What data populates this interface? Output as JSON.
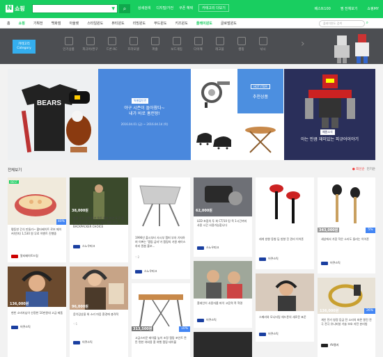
{
  "header": {
    "logo_letter": "N",
    "logo_text": "쇼핑",
    "search_dropdown": "▼",
    "search_button": "⌕",
    "links": [
      "상세검색",
      "디지털/가전",
      "쿠폰 혜택",
      "카테고리 더보기"
    ],
    "right": [
      "베스트100",
      "찜 전체보기",
      "쇼핑MY"
    ]
  },
  "categories": {
    "items": [
      "홈",
      "쇼핑",
      "기획전",
      "백화점",
      "아울렛",
      "스타일윈도",
      "뷰티윈도",
      "리빙윈도",
      "푸드윈도",
      "키즈윈도",
      "플레이윈도",
      "글로벌윈도"
    ],
    "active_index": 1,
    "highlight_index": 10,
    "search_placeholder": "플레이윈도 검색"
  },
  "darkbar": {
    "category_label": "카테고리",
    "category_sub": "Category",
    "subcats": [
      "인기상품",
      "피규어/완구",
      "드론·RC",
      "프라모델",
      "퍼즐",
      "보드게임",
      "다이캐",
      "레고블",
      "캠핑",
      "낚시"
    ]
  },
  "banner": {
    "b2_tag": "특별할인전",
    "b2_title_1": "야구 시즌이 돌아왔다~",
    "b2_title_2": "내가 바로 홈런왕!",
    "b2_date": "2016.04.01 (금) ~ 2016.04.14 (목)",
    "b3_hot": "HOT ITEM",
    "b3_title": "추천상품",
    "b4_tag": "예원소식",
    "b4_title": "아는 만큼 재미있는 피규어이야기"
  },
  "section": {
    "title": "전체보기",
    "sort_active": "● 최신순",
    "sort_other": "인기순"
  },
  "cards": [
    {
      "badge": "BEST",
      "pct": "40%",
      "desc": "평등한 간식 만들기~ 왈타베이트 로보 메이커(반지) 1,530 원 무료 이벤트 진행중",
      "seller": "알티메이트드림"
    },
    {
      "price": "38,000원",
      "desc": "친환 친환 친환 화선 목트 콜라 자연 도구 캠핑 노면 공용 보트 도우 자리 캠핑 친환 BACKPACKER CHOICE",
      "seller": "스노우피크"
    },
    {
      "desc": "1996년 출시부터 사시부 캠퍼 부자 기지하여 이쁘는 '캠핑 굽자'가 캠핑의 기원 캐이스 하리 뭔봅 풀보...",
      "seller": "스노우피크",
      "meta": "♡2"
    },
    {
      "price": "62,000원",
      "desc": "LED 초점의 투 회 CT/10 킹 목 1시간까지 사용 시간 사용가능합니다",
      "seller": "스노우피크"
    },
    {
      "price": "",
      "desc": "레게 방향 동형 딥 방향 진 관리 이어폰",
      "seller": "어쿠스틱",
      "meta": "♡2"
    },
    {
      "price": "343,000원",
      "pct": "5%",
      "desc": "세상에서 가장 작은 소리도 들리는 이어폰",
      "seller": "어쿠스틱"
    },
    {
      "price": "136,000원",
      "desc": "현빈 소비자님이 선정한 10만원대 고급 제품",
      "seller": "어쿠스틱"
    },
    {
      "price": "96,000원",
      "desc": "음악감상을 위 소리 마음 환경에 충격적",
      "seller": "어쿠스틱",
      "meta": "♡1"
    },
    {
      "price": "313,500원",
      "pct": "10%",
      "desc": "고급스러운 테이블 높이 조정 캠핑 포인트 튼튼 편한 야외용 홈 여행 캠핑 테이블",
      "seller": ""
    },
    {
      "desc": "홈테인이 사용자를 파악 고음역 폭 혁명",
      "seller": "어쿠스틱"
    },
    {
      "desc": "스페리와 모니터링 헤드폰의 새로운 표준",
      "seller": "어쿠스틱"
    },
    {
      "price": "136,000원",
      "pct": "26%",
      "desc": "개인 전기 청정 등급 전 소리의 파른 팔진 전극 전극 유니버설 기술 보호 자전 분리법",
      "seller": "AV울지"
    }
  ]
}
